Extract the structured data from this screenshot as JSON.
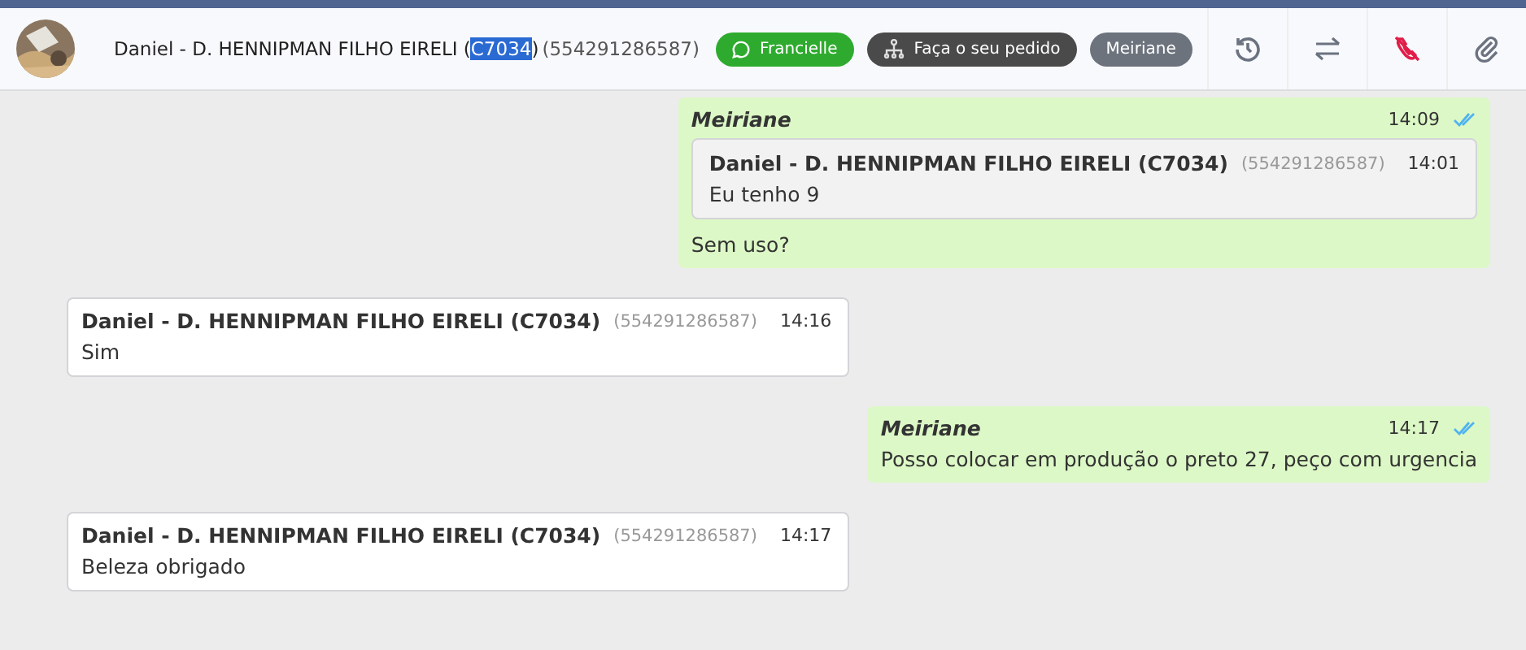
{
  "header": {
    "name_parts": [
      {
        "text": "Daniel - D. HENNIPMAN FILHO EIRELI (",
        "selected": false
      },
      {
        "text": "C7034",
        "selected": true
      },
      {
        "text": ")",
        "selected": false
      }
    ],
    "phone": "(554291286587)",
    "tags": [
      {
        "kind": "whatsapp",
        "label": "Francielle",
        "color": "#2eab2e"
      },
      {
        "kind": "flow",
        "label": "Faça o seu pedido",
        "color": "#4a4a4a"
      },
      {
        "kind": "plain",
        "label": "Meiriane",
        "color": "#6c737d"
      }
    ],
    "actions": [
      {
        "kind": "history"
      },
      {
        "kind": "transfer"
      },
      {
        "kind": "hangup"
      },
      {
        "kind": "attach"
      }
    ]
  },
  "messages": [
    {
      "kind": "outgoing",
      "author": "Meiriane",
      "time": "14:09",
      "read": true,
      "quote": {
        "author": "Daniel - D. HENNIPMAN FILHO EIRELI (C7034)",
        "phone": "(554291286587)",
        "time": "14:01",
        "text": "Eu tenho 9"
      },
      "text": "Sem uso?"
    },
    {
      "kind": "incoming",
      "author": "Daniel - D. HENNIPMAN FILHO EIRELI (C7034)",
      "phone": "(554291286587)",
      "time": "14:16",
      "text": "Sim"
    },
    {
      "kind": "outgoing",
      "author": "Meiriane",
      "time": "14:17",
      "read": true,
      "text": "Posso colocar em produção o preto 27, peço com urgencia"
    },
    {
      "kind": "incoming",
      "author": "Daniel - D. HENNIPMAN FILHO EIRELI (C7034)",
      "phone": "(554291286587)",
      "time": "14:17",
      "text": "Beleza obrigado"
    }
  ]
}
